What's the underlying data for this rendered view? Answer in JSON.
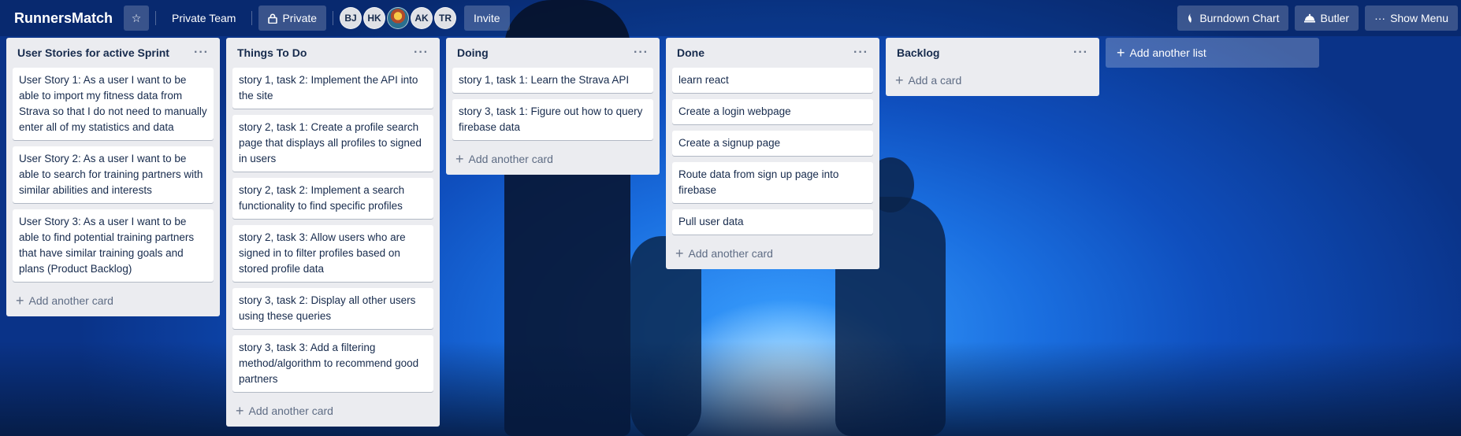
{
  "header": {
    "brand": "RunnersMatch",
    "team": "Private Team",
    "visibility": "Private",
    "members": [
      "BJ",
      "HK",
      "",
      "AK",
      "TR"
    ],
    "invite": "Invite",
    "burndown": "Burndown Chart",
    "butler": "Butler",
    "show_menu": "Show Menu"
  },
  "lists": [
    {
      "title": "User Stories for active Sprint",
      "cards": [
        "User Story 1: As a user I want to be able to import my fitness data from Strava so that I do not need to manually enter all of my statistics and data",
        "User Story 2: As a user I want to be able to search for training partners with similar abilities and interests",
        "User Story 3: As a user I want to be able to find potential training partners that have similar training goals and plans (Product Backlog)"
      ],
      "add_label": "Add another card"
    },
    {
      "title": "Things To Do",
      "cards": [
        "story 1, task 2: Implement the API into the site",
        "story 2, task 1: Create a profile search page that displays all profiles to signed in users",
        "story 2, task 2: Implement a search functionality to find specific profiles",
        "story 2, task 3: Allow users who are signed in to filter profiles based on stored profile data",
        "story 3, task 2: Display all other users using these queries",
        "story 3, task 3: Add a filtering method/algorithm to recommend good partners"
      ],
      "add_label": "Add another card"
    },
    {
      "title": "Doing",
      "cards": [
        "story 1, task 1: Learn the Strava API",
        "story 3, task 1: Figure out how to query firebase data"
      ],
      "add_label": "Add another card"
    },
    {
      "title": "Done",
      "cards": [
        "learn react",
        "Create a login webpage",
        "Create a signup page",
        "Route data from sign up page into firebase",
        "Pull user data"
      ],
      "add_label": "Add another card"
    },
    {
      "title": "Backlog",
      "cards": [],
      "add_label": "Add a card"
    }
  ],
  "add_list_label": "Add another list",
  "icons": {
    "star": "star-icon",
    "lock": "lock-icon",
    "burndown": "burndown-icon",
    "butler": "butler-icon",
    "menu": "more-icon",
    "plus": "plus-icon"
  }
}
